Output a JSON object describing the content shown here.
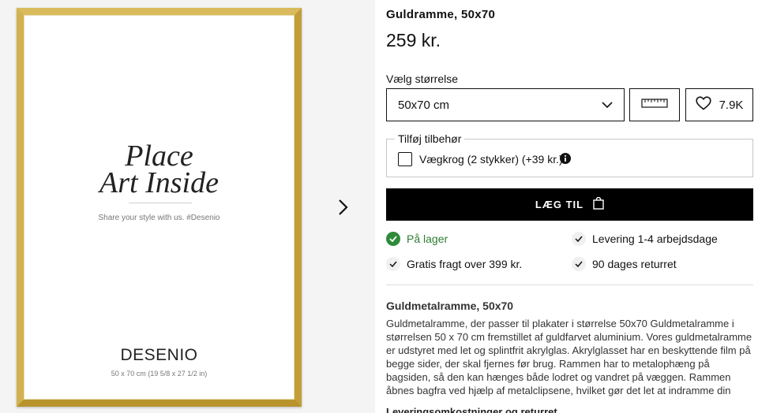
{
  "gallery": {
    "poster": {
      "title_line1": "Place",
      "title_line2": "Art Inside",
      "tagline": "Share your style with us. #Desenio",
      "brand": "DESENIO",
      "size_text": "50 x 70 cm  (19 5/8 x 27 1/2 in)"
    },
    "frame_color": "#c9a53f"
  },
  "product": {
    "title": "Guldramme, 50x70",
    "price": "259 kr."
  },
  "size": {
    "label": "Vælg størrelse",
    "selected": "50x70 cm"
  },
  "wishlist": {
    "count": "7.9K",
    "icon": "heart-icon"
  },
  "ruler_icon": "ruler-icon",
  "accessories": {
    "legend": "Tilføj tilbehør",
    "item_label": "Vægkrog (2 stykker)  (+39 kr.)",
    "checked": false
  },
  "add_to_cart": {
    "label": "LÆG TIL",
    "icon": "shopping-bag-icon"
  },
  "usps": {
    "stock": "På lager",
    "delivery": "Levering 1-4 arbejdsdage",
    "shipping": "Gratis fragt over 399 kr.",
    "returns": "90 dages returret"
  },
  "description": {
    "heading": "Guldmetalramme, 50x70",
    "body": "Guldmetalramme, der passer til plakater i størrelse 50x70 Guldmetalramme i størrelsen 50 x 70 cm fremstillet af guldfarvet aluminium. Vores guldmetalramme er udstyret med let og splintfrit akrylglas. Akrylglasset har en beskyttende film på begge sider, der skal fjernes før brug. Rammen har to metalophæng på bagsiden, så den kan hænges både lodret og vandret på væggen. Rammen åbnes bagfra ved hjælp af metalclipsene, hvilket gør det let at indramme din",
    "tail": "Leveringsomkostninger og returret"
  },
  "colors": {
    "accent": "#000000",
    "stock_green": "#2e7d32",
    "gold": "#c9a53f"
  }
}
